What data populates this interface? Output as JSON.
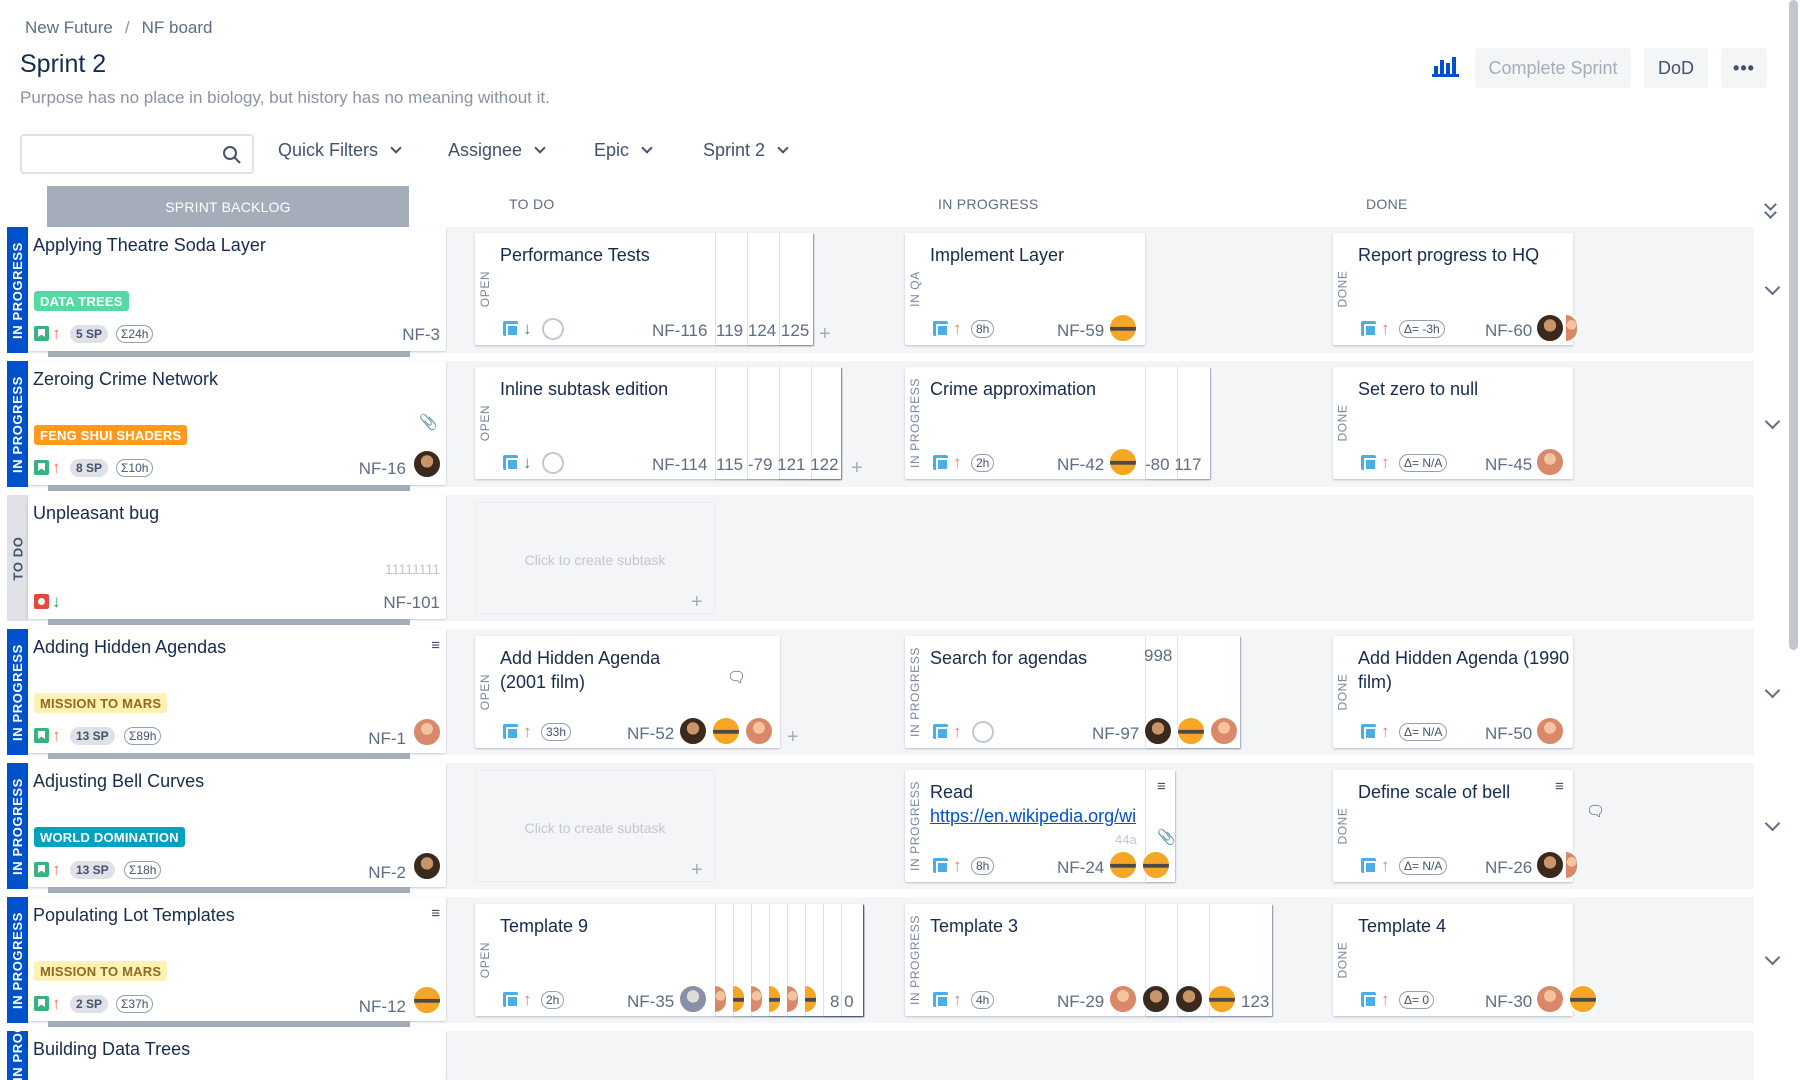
{
  "breadcrumb": {
    "project": "New Future",
    "separator": "/",
    "board": "NF board"
  },
  "header": {
    "title": "Sprint 2",
    "subtitle": "Purpose has no place in biology, but history has no meaning without it.",
    "complete_sprint": "Complete Sprint",
    "dod": "DoD",
    "more": "•••"
  },
  "filters": {
    "search_placeholder": "",
    "quick_filters": "Quick Filters",
    "assignee": "Assignee",
    "epic": "Epic",
    "sprint": "Sprint 2"
  },
  "columns": {
    "backlog": "SPRINT BACKLOG",
    "todo": "TO DO",
    "in_progress": "IN PROGRESS",
    "done": "DONE"
  },
  "lanes": [
    {
      "status": "IN PROGRESS",
      "story": {
        "title": "Applying Theatre Soda Layer",
        "epic": "DATA TREES",
        "sp": "5 SP",
        "est": "Σ24h",
        "key": "NF-3"
      },
      "todo": {
        "status": "OPEN",
        "title": "Performance Tests",
        "key": "NF-116",
        "stack": "119 124 125"
      },
      "progress": {
        "status": "IN QA",
        "title": "Implement Layer",
        "est": "8h",
        "key": "NF-59"
      },
      "done": {
        "status": "DONE",
        "title": "Report progress to HQ",
        "est": "Δ= -3h",
        "key": "NF-60"
      }
    },
    {
      "status": "IN PROGRESS",
      "story": {
        "title": "Zeroing Crime Network",
        "epic": "FENG SHUI SHADERS",
        "sp": "8 SP",
        "est": "Σ10h",
        "key": "NF-16"
      },
      "todo": {
        "status": "OPEN",
        "title": "Inline subtask edition",
        "key": "NF-114",
        "stack": "115 -79 121 122"
      },
      "progress": {
        "status": "IN PROGRESS",
        "title": "Crime approximation",
        "est": "2h",
        "key": "NF-42",
        "stack": "-80 117"
      },
      "done": {
        "status": "DONE",
        "title": "Set zero to null",
        "est": "Δ= N/A",
        "key": "NF-45"
      }
    },
    {
      "status": "TO DO",
      "story": {
        "title": "Unpleasant bug",
        "extra": "11111111",
        "key": "NF-101"
      },
      "todo": {
        "placeholder": "Click to create subtask"
      }
    },
    {
      "status": "IN PROGRESS",
      "story": {
        "title": "Adding Hidden Agendas",
        "epic": "MISSION TO MARS",
        "sp": "13 SP",
        "est": "Σ89h",
        "key": "NF-1"
      },
      "todo": {
        "status": "OPEN",
        "title": "Add Hidden Agenda (2001 film)",
        "est": "33h",
        "key": "NF-52"
      },
      "progress": {
        "status": "IN PROGRESS",
        "title": "Search for agendas",
        "key": "NF-97",
        "stack": "998"
      },
      "done": {
        "status": "DONE",
        "title": "Add Hidden Agenda (1990 film)",
        "est": "Δ= N/A",
        "key": "NF-50"
      }
    },
    {
      "status": "IN PROGRESS",
      "story": {
        "title": "Adjusting Bell Curves",
        "epic": "WORLD DOMINATION",
        "sp": "13 SP",
        "est": "Σ18h",
        "key": "NF-2"
      },
      "todo": {
        "placeholder": "Click to create subtask"
      },
      "progress": {
        "status": "IN PROGRESS",
        "title": "Read",
        "link": "https://en.wikipedia.org/wi",
        "extra": "44a",
        "est": "8h",
        "key": "NF-24"
      },
      "done": {
        "status": "DONE",
        "title": "Define scale of bell",
        "est": "Δ= N/A",
        "key": "NF-26"
      }
    },
    {
      "status": "IN PROGRESS",
      "story": {
        "title": "Populating Lot Templates",
        "epic": "MISSION TO MARS",
        "sp": "2 SP",
        "est": "Σ37h",
        "key": "NF-12"
      },
      "todo": {
        "status": "OPEN",
        "title": "Template 9",
        "est": "2h",
        "key": "NF-35",
        "stack": "8 0"
      },
      "progress": {
        "status": "IN PROGRESS",
        "title": "Template 3",
        "est": "4h",
        "key": "NF-29",
        "stack": "123"
      },
      "done": {
        "status": "DONE",
        "title": "Template 4",
        "est": "Δ= 0",
        "key": "NF-30"
      }
    },
    {
      "status": "IN PROGRESS",
      "story": {
        "title": "Building Data Trees"
      }
    }
  ],
  "colors": {
    "epic_data_trees": "#57d9a3",
    "epic_feng_shui": "#ff991f",
    "epic_mission": "#fff0b3",
    "epic_world": "#00a3bf",
    "accent": "#0052cc"
  }
}
